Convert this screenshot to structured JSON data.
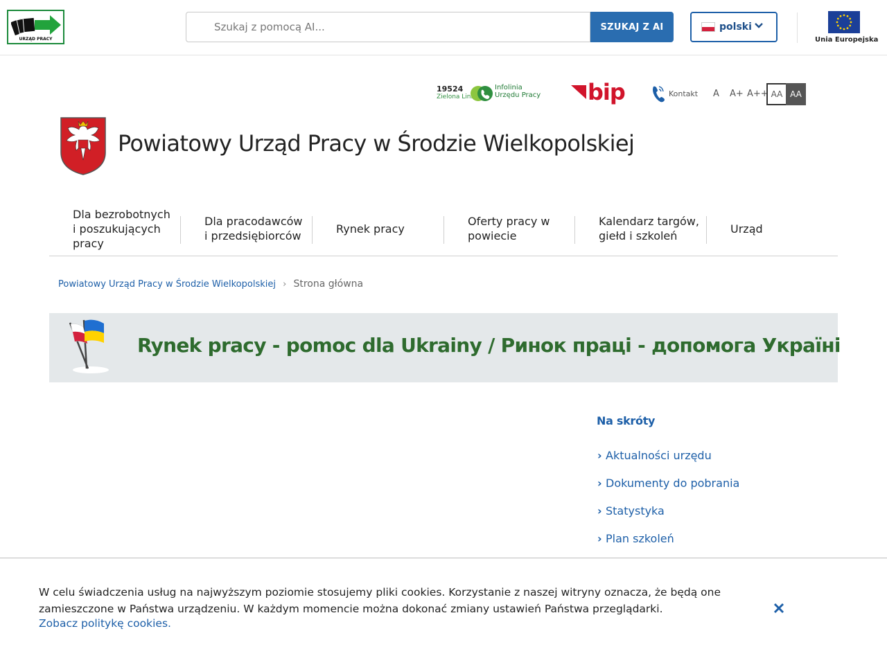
{
  "header": {
    "logo_text": "URZĄD PRACY",
    "search": {
      "placeholder": "Szukaj z pomocą AI...",
      "button": "SZUKAJ Z AI"
    },
    "language": {
      "selected": "polski"
    },
    "eu_label": "Unia Europejska"
  },
  "utility": {
    "infolinia": {
      "number": "19524",
      "subtitle": "Zielona Linia",
      "line1": "Infolinia",
      "line2": "Urzędu Pracy"
    },
    "bip_label": "bip",
    "contact_label": "Kontakt",
    "font_sizes": [
      "A",
      "A+",
      "A++"
    ],
    "contrast": [
      "AA",
      "AA"
    ]
  },
  "site": {
    "title": "Powiatowy Urząd Pracy w Środzie Wielkopolskiej"
  },
  "nav": {
    "items": [
      "Dla bezrobotnych i poszukujących pracy",
      "Dla pracodawców i przedsiębiorców",
      "Rynek pracy",
      "Oferty pracy w powiecie",
      "Kalendarz targów, giełd i szkoleń",
      "Urząd"
    ]
  },
  "breadcrumb": {
    "home": "Powiatowy Urząd Pracy w Środzie Wielkopolskiej",
    "current": "Strona główna"
  },
  "banner": {
    "text": "Rynek pracy - pomoc dla Ukrainy / Ринок праці - допомога Україні"
  },
  "shortcuts": {
    "title": "Na skróty",
    "items": [
      "Aktualności urzędu",
      "Dokumenty do pobrania",
      "Statystyka",
      "Plan szkoleń"
    ]
  },
  "cookie": {
    "text": "W celu świadczenia usług na najwyższym poziomie stosujemy pliki cookies. Korzystanie z naszej witryny oznacza, że będą one zamieszczone w Państwa urządzeniu. W każdym momencie można dokonać zmiany ustawień Państwa przeglądarki.",
    "link": "Zobacz politykę cookies."
  },
  "colors": {
    "primary": "#1d5fa8",
    "search_button": "#2a6db0",
    "bip_red": "#d1142b",
    "banner_green": "#2e6b2e",
    "eu_blue": "#1b3f98"
  }
}
